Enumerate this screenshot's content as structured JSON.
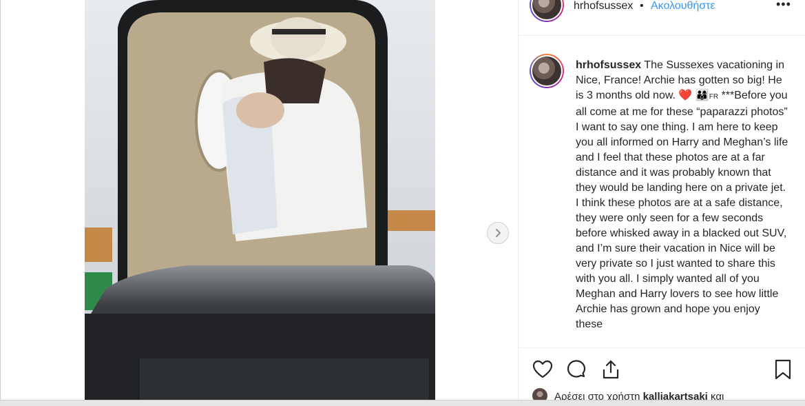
{
  "post": {
    "username": "hrhofsussex",
    "separator": "•",
    "follow_label": "Ακολουθήστε",
    "more_label": "•••"
  },
  "caption": {
    "username": "hrhofsussex",
    "text_1": " The Sussexes vacationing in Nice, France! Archie has gotten so big! He is 3 months old now. ",
    "heart": "❤️",
    "family_emoji": "👨‍👩‍👦",
    "fr": "FR",
    "text_2": " ***Before you all come at me for these “paparazzi photos” I want to say one thing. I am here to keep you all informed on Harry and Meghan’s life and I feel that these photos are at a far distance and it was probably known that they would be landing here on a private jet. I think these photos are at a safe distance, they were only seen for a few seconds before whisked away in a blacked out SUV, and I’m sure their vacation in Nice will be very private so I just wanted to share this with you all. I simply wanted all of you Meghan and Harry lovers to see how little Archie has grown and hope you enjoy these"
  },
  "actions": {
    "icons": [
      "heart-icon",
      "comment-icon",
      "share-icon",
      "bookmark-icon"
    ]
  },
  "likes": {
    "prefix": "Αρέσει στο χρήστη ",
    "user": "kalliakartsaki",
    "suffix": " και"
  },
  "colors": {
    "link": "#3897f0",
    "text": "#262626",
    "divider": "#efefef"
  }
}
